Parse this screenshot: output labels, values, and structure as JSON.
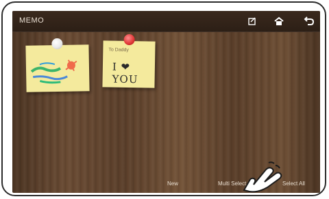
{
  "app": {
    "title": "MEMO"
  },
  "topbar": {
    "icons": [
      "edit-icon",
      "home-icon",
      "back-icon"
    ]
  },
  "notes": [
    {
      "id": "note-1",
      "pin_color": "#ffffff",
      "kind": "drawing"
    },
    {
      "id": "note-2",
      "pin_color": "#e23b3b",
      "small_label": "To Daddy",
      "text": "I ❤ YOU"
    }
  ],
  "actions": {
    "new_label": "New",
    "multi_select_label": "Multi Select",
    "select_all_label": "Select All"
  },
  "colors": {
    "note_yellow": "#f4ea9d",
    "wood_dark": "#4b3422",
    "wood_mid": "#6a4b33",
    "topbar": "#2c1f16"
  }
}
